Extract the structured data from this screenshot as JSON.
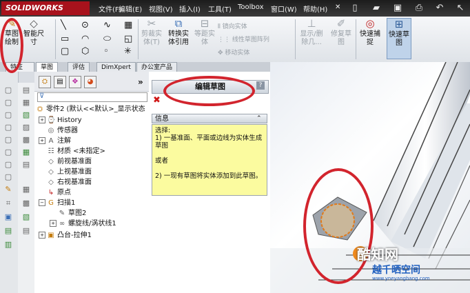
{
  "app": {
    "logo_text": "SOLIDWORKS"
  },
  "menu": [
    "文件(F)",
    "编辑(E)",
    "视图(V)",
    "插入(I)",
    "工具(T)",
    "Toolbox",
    "窗口(W)",
    "帮助(H)"
  ],
  "pin": "✕",
  "command": {
    "sketch": "草图绘制",
    "dimension": "智能尺寸",
    "trim": "剪裁实体(T)",
    "convert": "转换实体引用",
    "offset": "等距实体",
    "mirror": "镜向实体",
    "linear_pattern": "线性草图阵列",
    "move": "移动实体",
    "show_delete": "显示/删除几...",
    "repair": "修复草图",
    "quick_snap": "快速捕捉",
    "quick_sketch": "快速草图",
    "feature_tab": "特征"
  },
  "tabs": [
    "草图",
    "评估",
    "DimXpert",
    "办公室产品"
  ],
  "tree": {
    "root": "零件2 (默认<<默认>_显示状态",
    "items": [
      {
        "label": "History",
        "icon": "history-icon"
      },
      {
        "label": "传感器",
        "icon": "sensor-icon"
      },
      {
        "label": "注解",
        "icon": "annotation-icon"
      },
      {
        "label": "材质 <未指定>",
        "icon": "material-icon"
      },
      {
        "label": "前视基准面",
        "icon": "plane-icon"
      },
      {
        "label": "上视基准面",
        "icon": "plane-icon"
      },
      {
        "label": "右视基准面",
        "icon": "plane-icon"
      },
      {
        "label": "原点",
        "icon": "origin-icon"
      },
      {
        "label": "扫描1",
        "icon": "sweep-icon"
      },
      {
        "label": "草图2",
        "icon": "sketch-icon"
      },
      {
        "label": "螺旋线/涡状线1",
        "icon": "helix-icon"
      },
      {
        "label": "凸台-拉伸1",
        "icon": "extrude-icon"
      }
    ]
  },
  "property_manager": {
    "title": "编辑草图",
    "help": "?",
    "close": "✖",
    "info_header": "信息",
    "info_collapse": "⌃",
    "info_lines": [
      "选择:",
      "1) 一基准面、平面或边线为实体生成草图",
      "或者",
      "2) 一现有草图将实体添加到此草图。"
    ]
  },
  "watermark": {
    "main": "酷知网",
    "sub1": "越千晒空间",
    "sub2": "www.yneyangbang.com"
  },
  "colors": {
    "annotation_red": "#d2242d",
    "info_yellow": "#fbfb9f",
    "title_red": "#a8121c"
  }
}
